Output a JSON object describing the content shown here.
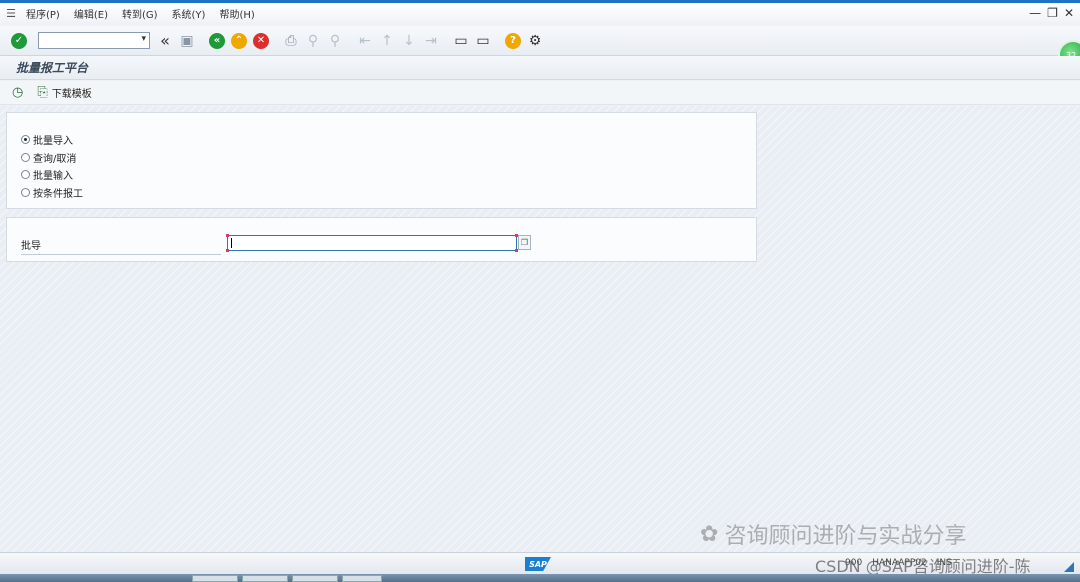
{
  "menu": {
    "items": [
      "程序(P)",
      "编辑(E)",
      "转到(G)",
      "系统(Y)",
      "帮助(H)"
    ]
  },
  "window_controls": [
    "—",
    "❐",
    "✕"
  ],
  "toolbar": {
    "command_field_value": "",
    "icons": [
      "enter-icon",
      "back-double-icon",
      "save-icon",
      "back-icon",
      "exit-icon",
      "cancel-icon",
      "print-icon",
      "find-icon",
      "find-next-icon",
      "first-page-icon",
      "prev-page-icon",
      "next-page-icon",
      "last-page-icon",
      "create-session-icon",
      "shortcut-icon",
      "help-icon",
      "customize-layout-icon"
    ]
  },
  "status_orb": "32",
  "title": "批量报工平台",
  "app_toolbar": {
    "download_label": "下载模板"
  },
  "options": {
    "items": [
      {
        "label": "批量导入",
        "selected": true
      },
      {
        "label": "查询/取消",
        "selected": false
      },
      {
        "label": "批量输入",
        "selected": false
      },
      {
        "label": "按条件报工",
        "selected": false
      }
    ]
  },
  "field": {
    "label": "批导",
    "value": ""
  },
  "watermark": {
    "text": "咨询顾问进阶与实战分享",
    "csdn": "CSDN @SAP咨询顾问进阶-陈"
  },
  "statusbar": {
    "logo": "SAP",
    "segments": [
      "900",
      "HANAAPP02",
      "INS"
    ]
  },
  "colors": {
    "accent": "#1b74c4",
    "ok_green": "#1f9a3a",
    "warn_yellow": "#f0a800",
    "cancel_red": "#d9302c"
  }
}
